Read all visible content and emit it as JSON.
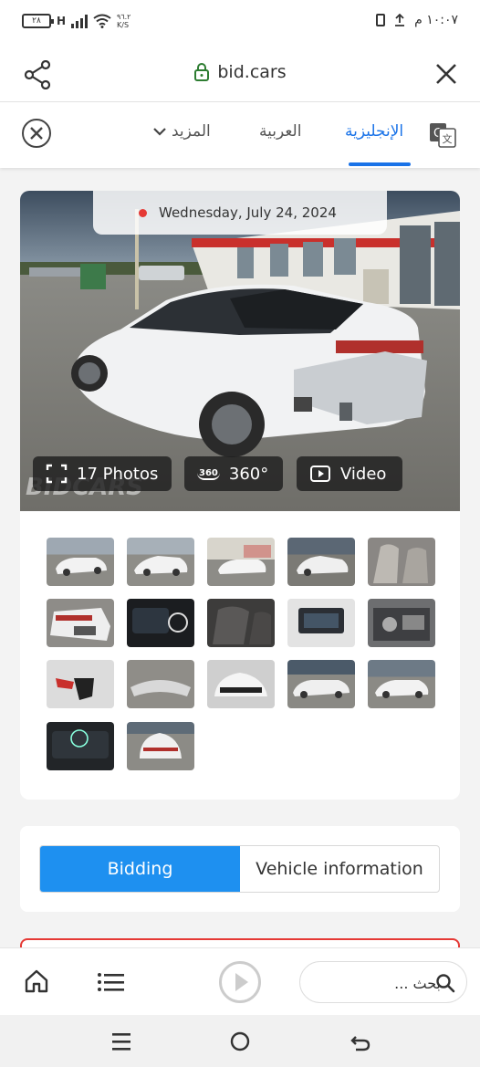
{
  "status_bar": {
    "battery": "٢٨",
    "network": "H",
    "speed": "٩٦.٢",
    "speed_unit": "K/S",
    "time": "١٠:٠٧ م"
  },
  "url_bar": {
    "domain": "bid.cars"
  },
  "translate_bar": {
    "tabs": [
      "الإنجليزية",
      "العربية",
      "المزيد"
    ],
    "active_tab": "الإنجليزية"
  },
  "listing": {
    "date": "Wednesday, July 24, 2024",
    "photos_label": "17 Photos",
    "view360_label": "360°",
    "view360_badge": "360",
    "video_label": "Video",
    "watermark": "BIDCARS",
    "thumbnail_count": 17
  },
  "tabs": {
    "bidding": "Bidding",
    "vehicle_info": "Vehicle information",
    "active": "Bidding"
  },
  "browser_bottom": {
    "search_placeholder": "بحث ..."
  },
  "colors": {
    "accent": "#1e90f0",
    "translate_accent": "#1a73e8",
    "date_dot": "#e53935"
  }
}
